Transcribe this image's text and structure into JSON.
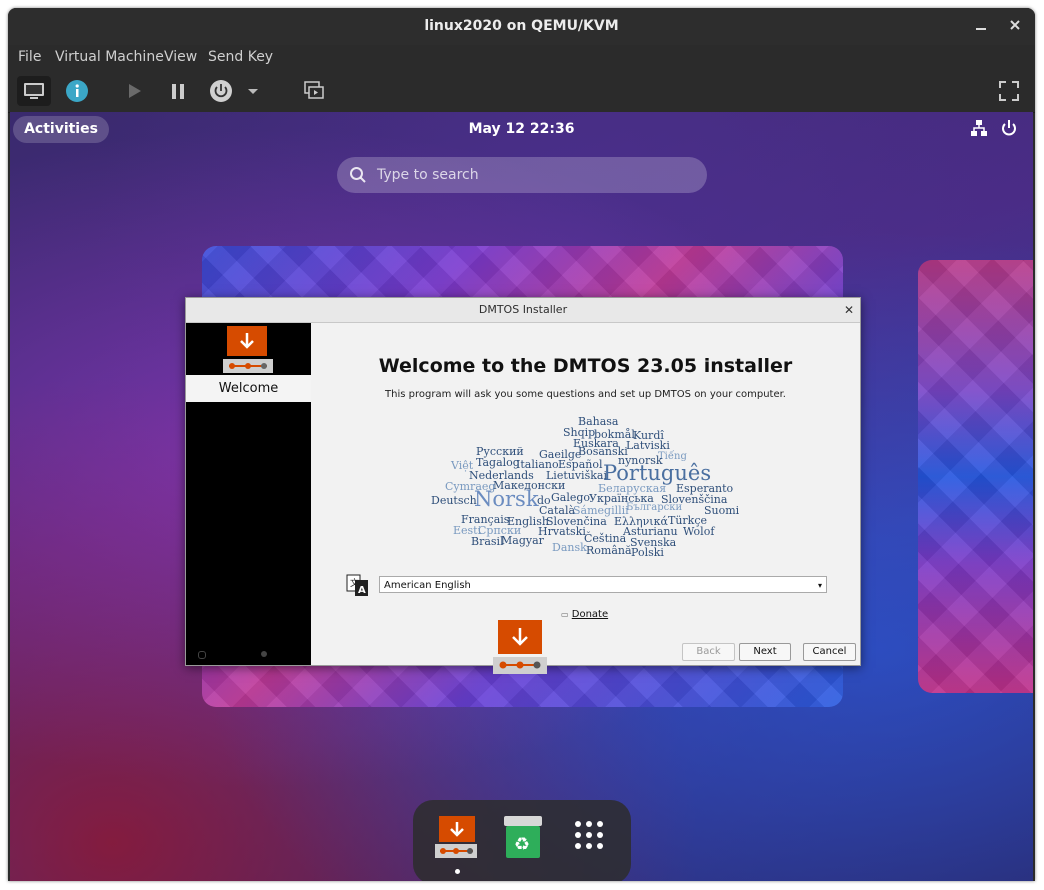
{
  "window": {
    "title": "linux2020 on QEMU/KVM"
  },
  "menubar": {
    "items": [
      "File",
      "Virtual Machine",
      "View",
      "Send Key"
    ]
  },
  "toolbar": {
    "icons": [
      "console-icon",
      "details-icon",
      "run-icon",
      "pause-icon",
      "power-icon",
      "power-menu-icon",
      "snapshots-icon",
      "fullscreen-icon"
    ]
  },
  "gnome": {
    "activities": "Activities",
    "clock": "May 12  22:36",
    "search_placeholder": "Type to search"
  },
  "installer": {
    "title": "DMTOS Installer",
    "sidebar_item": "Welcome",
    "heading": "Welcome to the DMTOS 23.05 installer",
    "subtitle": "This program will ask you some questions and set up DMTOS on your computer.",
    "language_value": "American English",
    "donate_label": "Donate",
    "back_label": "Back",
    "next_label": "Next",
    "cancel_label": "Cancel",
    "word_cloud": [
      "Bahasa",
      "Shqip",
      "bokmål",
      "Kurdî",
      "Euskara",
      "Latviski",
      "Русский",
      "Gaeilge",
      "Bosanski",
      "Tiếng",
      "Việt",
      "Tagalog",
      "Italiano",
      "Español",
      "nynorsk",
      "Nederlands",
      "Lietuviškai",
      "Português",
      "Cymraeg",
      "Македонски",
      "Беларуская",
      "Esperanto",
      "Deutsch",
      "Norsk",
      "do",
      "Galego",
      "Українська",
      "Slovenščina",
      "Català",
      "Sámegillii",
      "Български",
      "Suomi",
      "Français",
      "English",
      "Slovenčina",
      "Ελληνικά",
      "Türkçe",
      "Eesti",
      "Српски",
      "Hrvatski",
      "Asturianu",
      "Wolof",
      "Brasil",
      "Magyar",
      "Čeština",
      "Svenska",
      "Dansk",
      "Română",
      "Polski"
    ]
  },
  "colors": {
    "accent_orange": "#d64b00",
    "titlebar": "#2d2d2d"
  }
}
